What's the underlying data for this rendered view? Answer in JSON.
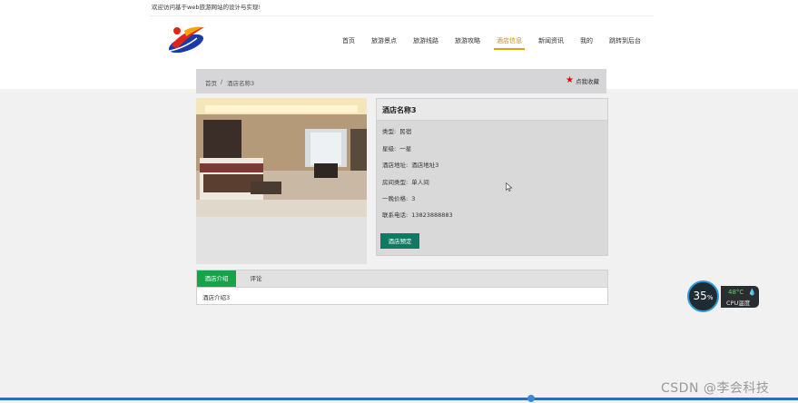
{
  "header": {
    "welcome": "欢迎访问基于web旅游网站的设计与实现!",
    "nav": [
      {
        "label": "首页",
        "active": false
      },
      {
        "label": "旅游景点",
        "active": false
      },
      {
        "label": "旅游线路",
        "active": false
      },
      {
        "label": "旅游攻略",
        "active": false
      },
      {
        "label": "酒店信息",
        "active": true
      },
      {
        "label": "新闻资讯",
        "active": false
      },
      {
        "label": "我的",
        "active": false
      },
      {
        "label": "跳转到后台",
        "active": false
      }
    ],
    "accent": "#e8a000"
  },
  "breadcrumb": {
    "home": "首页",
    "sep": "/",
    "current": "酒店名称3",
    "favorite": "点我收藏"
  },
  "hotel": {
    "name": "酒店名称3",
    "fields": [
      {
        "label": "类型:",
        "value": "民宿"
      },
      {
        "label": "星级:",
        "value": "一星"
      },
      {
        "label": "酒店地址:",
        "value": "酒店地址3"
      },
      {
        "label": "房间类型:",
        "value": "单人间"
      },
      {
        "label": "一晚价格:",
        "value": "3"
      },
      {
        "label": "联系电话:",
        "value": "13823888883"
      }
    ],
    "order_button": "酒店预定",
    "order_color": "#0d7a62"
  },
  "tabs": {
    "items": [
      "酒店介绍",
      "评论"
    ],
    "active_color": "#16a34a",
    "content": "酒店介绍3"
  },
  "widget": {
    "percent": "35",
    "percent_sign": "%",
    "temp": "48°C",
    "temp_label": "CPU温度"
  },
  "watermark": "CSDN @李会科技"
}
